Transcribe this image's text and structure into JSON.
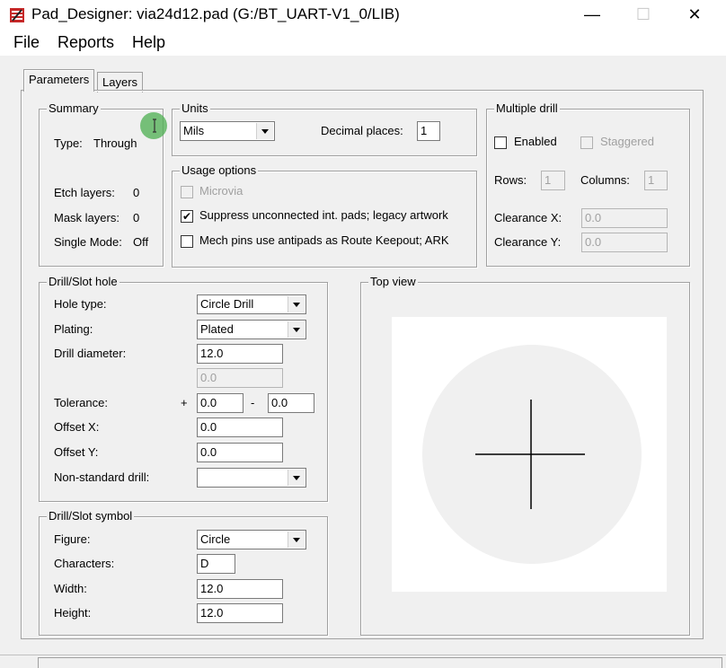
{
  "window": {
    "title": "Pad_Designer: via24d12.pad (G:/BT_UART-V1_0/LIB)",
    "min_glyph": "—",
    "max_glyph": "☐",
    "close_glyph": "✕"
  },
  "menu": {
    "file": "File",
    "reports": "Reports",
    "help": "Help"
  },
  "tabs": {
    "parameters": "Parameters",
    "layers": "Layers"
  },
  "summary": {
    "title": "Summary",
    "type_label": "Type:",
    "type_value": "Through",
    "etch_label": "Etch layers:",
    "etch_value": "0",
    "mask_label": "Mask layers:",
    "mask_value": "0",
    "single_label": "Single Mode:",
    "single_value": "Off"
  },
  "units": {
    "title": "Units",
    "unit_value": "Mils",
    "decimal_label": "Decimal places:",
    "decimal_value": "1"
  },
  "usage": {
    "title": "Usage options",
    "microvia": "Microvia",
    "suppress": "Suppress unconnected int. pads; legacy artwork",
    "mech": "Mech pins use antipads as Route Keepout; ARK",
    "check_mark": "✔"
  },
  "multiple_drill": {
    "title": "Multiple drill",
    "enabled": "Enabled",
    "staggered": "Staggered",
    "rows_label": "Rows:",
    "rows_value": "1",
    "columns_label": "Columns:",
    "columns_value": "1",
    "clearance_x_label": "Clearance X:",
    "clearance_x_value": "0.0",
    "clearance_y_label": "Clearance Y:",
    "clearance_y_value": "0.0"
  },
  "drill_hole": {
    "title": "Drill/Slot hole",
    "hole_type_label": "Hole type:",
    "hole_type_value": "Circle Drill",
    "plating_label": "Plating:",
    "plating_value": "Plated",
    "diameter_label": "Drill diameter:",
    "diameter_value": "12.0",
    "second_value": "0.0",
    "tolerance_label": "Tolerance:",
    "plus": "+",
    "minus": "-",
    "tol_plus_value": "0.0",
    "tol_minus_value": "0.0",
    "offset_x_label": "Offset X:",
    "offset_x_value": "0.0",
    "offset_y_label": "Offset Y:",
    "offset_y_value": "0.0",
    "nonstandard_label": "Non-standard drill:",
    "nonstandard_value": ""
  },
  "drill_symbol": {
    "title": "Drill/Slot symbol",
    "figure_label": "Figure:",
    "figure_value": "Circle",
    "characters_label": "Characters:",
    "characters_value": "D",
    "width_label": "Width:",
    "width_value": "12.0",
    "height_label": "Height:",
    "height_value": "12.0"
  },
  "top_view": {
    "title": "Top view"
  },
  "colors": {
    "cursor_highlight": "#4caf50",
    "preview_circle": "#f0f0f0"
  }
}
